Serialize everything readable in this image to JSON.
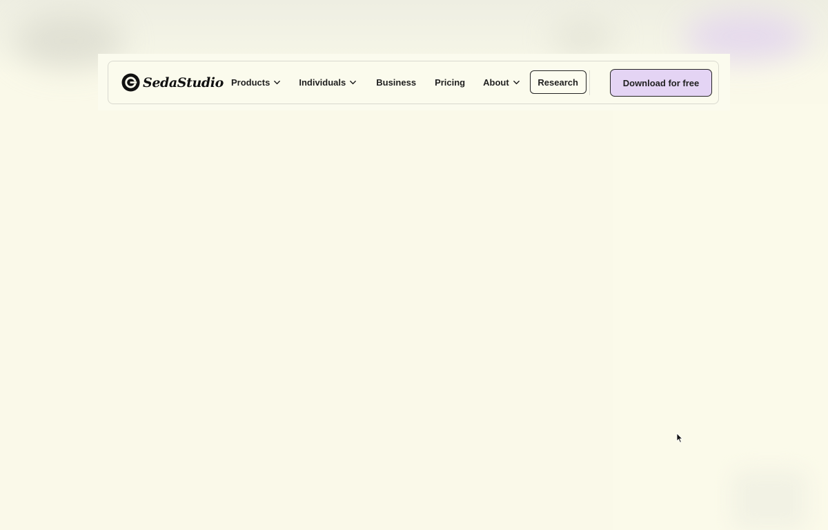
{
  "brand": {
    "name": "SedaStudio",
    "logo_icon": "seda-logo-icon"
  },
  "nav": {
    "items": [
      {
        "label": "Products",
        "has_dropdown": true
      },
      {
        "label": "Individuals",
        "has_dropdown": true
      },
      {
        "label": "Business",
        "has_dropdown": false
      },
      {
        "label": "Pricing",
        "has_dropdown": false
      },
      {
        "label": "About",
        "has_dropdown": true
      }
    ],
    "research_label": "Research",
    "download_label": "Download for free"
  },
  "colors": {
    "background": "#faf9e9",
    "download_button_bg": "#e4d4f4",
    "text": "#1e1e1e",
    "border": "#222222"
  },
  "icons": {
    "dropdown": "chevron-down-icon",
    "pointer": "mouse-cursor-icon"
  }
}
